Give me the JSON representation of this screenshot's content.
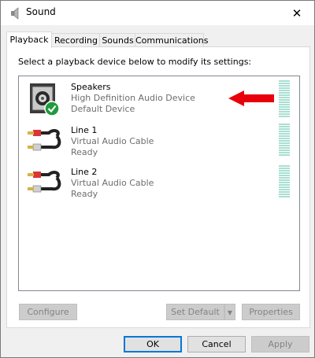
{
  "window": {
    "title": "Sound",
    "close_glyph": "✕"
  },
  "tabs": [
    {
      "label": "Playback",
      "active": true
    },
    {
      "label": "Recording",
      "active": false
    },
    {
      "label": "Sounds",
      "active": false
    },
    {
      "label": "Communications",
      "active": false
    }
  ],
  "panel": {
    "instruction": "Select a playback device below to modify its settings:",
    "devices": [
      {
        "name": "Speakers",
        "description": "High Definition Audio Device",
        "status": "Default Device",
        "icon": "speaker-icon",
        "is_default": true
      },
      {
        "name": "Line 1",
        "description": "Virtual Audio Cable",
        "status": "Ready",
        "icon": "rca-cable-icon",
        "is_default": false
      },
      {
        "name": "Line 2",
        "description": "Virtual Audio Cable",
        "status": "Ready",
        "icon": "rca-cable-icon",
        "is_default": false
      }
    ],
    "annotation_color": "#e8000b",
    "meter_color": "#a9dfd3"
  },
  "buttons": {
    "configure": {
      "label": "Configure",
      "enabled": false
    },
    "set_default": {
      "label": "Set Default",
      "enabled": false
    },
    "properties": {
      "label": "Properties",
      "enabled": false
    },
    "ok": {
      "label": "OK",
      "enabled": true
    },
    "cancel": {
      "label": "Cancel",
      "enabled": true
    },
    "apply": {
      "label": "Apply",
      "enabled": false
    }
  }
}
